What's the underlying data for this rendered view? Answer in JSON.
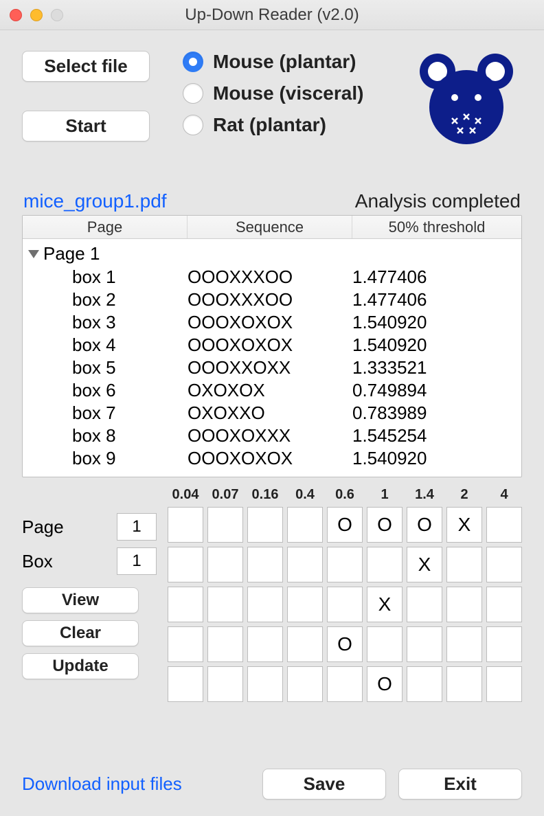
{
  "window": {
    "title": "Up-Down Reader (v2.0)"
  },
  "buttons": {
    "select_file": "Select file",
    "start": "Start",
    "view": "View",
    "clear": "Clear",
    "update": "Update",
    "save": "Save",
    "exit": "Exit"
  },
  "radios": {
    "options": [
      "Mouse (plantar)",
      "Mouse (visceral)",
      "Rat (plantar)"
    ],
    "selected": 0
  },
  "file": {
    "name": "mice_group1.pdf"
  },
  "status": "Analysis completed",
  "table": {
    "headers": [
      "Page",
      "Sequence",
      "50% threshold"
    ],
    "page_label": "Page 1",
    "rows": [
      {
        "box": "box 1",
        "seq": "OOOXXXOO",
        "thr": "1.477406"
      },
      {
        "box": "box 2",
        "seq": "OOOXXXOO",
        "thr": "1.477406"
      },
      {
        "box": "box 3",
        "seq": "OOOXOXOX",
        "thr": "1.540920"
      },
      {
        "box": "box 4",
        "seq": "OOOXOXOX",
        "thr": "1.540920"
      },
      {
        "box": "box 5",
        "seq": "OOOXXOXX",
        "thr": "1.333521"
      },
      {
        "box": "box 6",
        "seq": "OXOXOX",
        "thr": "0.749894"
      },
      {
        "box": "box 7",
        "seq": "OXOXXO",
        "thr": "0.783989"
      },
      {
        "box": "box 8",
        "seq": "OOOXOXXX",
        "thr": "1.545254"
      },
      {
        "box": "box 9",
        "seq": "OOOXOXOX",
        "thr": "1.540920"
      }
    ]
  },
  "editor": {
    "page_label": "Page",
    "box_label": "Box",
    "page_value": "1",
    "box_value": "1",
    "col_headers": [
      "0.04",
      "0.07",
      "0.16",
      "0.4",
      "0.6",
      "1",
      "1.4",
      "2",
      "4"
    ],
    "grid": [
      [
        "",
        "",
        "",
        "",
        "O",
        "O",
        "O",
        "X",
        ""
      ],
      [
        "",
        "",
        "",
        "",
        "",
        "",
        "X",
        "",
        ""
      ],
      [
        "",
        "",
        "",
        "",
        "",
        "X",
        "",
        "",
        ""
      ],
      [
        "",
        "",
        "",
        "",
        "O",
        "",
        "",
        "",
        ""
      ],
      [
        "",
        "",
        "",
        "",
        "",
        "O",
        "",
        "",
        ""
      ]
    ]
  },
  "footer": {
    "download": "Download input files"
  }
}
